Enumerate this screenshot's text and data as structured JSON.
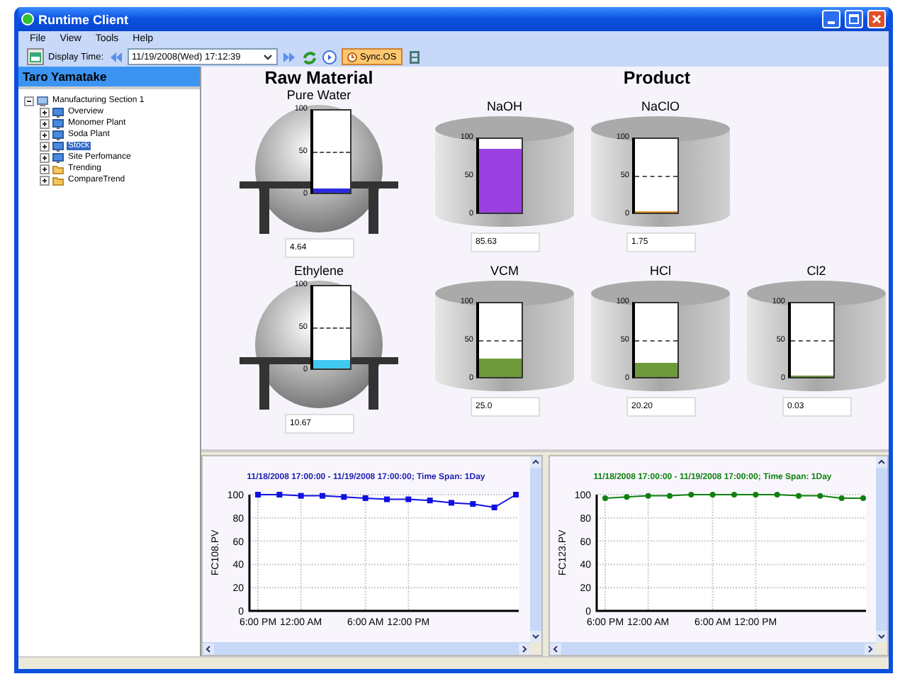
{
  "window": {
    "title": "Runtime Client"
  },
  "menu": [
    "File",
    "View",
    "Tools",
    "Help"
  ],
  "toolbar": {
    "time_label": "Display Time:",
    "time_value": "11/19/2008(Wed) 17:12:39",
    "sync_button": "Sync.OS"
  },
  "sidebar": {
    "user": "Taro Yamatake",
    "tree": [
      {
        "label": "Manufacturing Section 1",
        "kind": "site",
        "expanded": true,
        "selected": false,
        "children": [
          {
            "label": "Overview",
            "kind": "screen",
            "expanded": false,
            "selected": false
          },
          {
            "label": "Monomer Plant",
            "kind": "screen",
            "expanded": false,
            "selected": false
          },
          {
            "label": "Soda Plant",
            "kind": "screen",
            "expanded": false,
            "selected": false
          },
          {
            "label": "Stock",
            "kind": "screen",
            "expanded": false,
            "selected": true
          },
          {
            "label": "Site Perfomance",
            "kind": "screen",
            "expanded": false,
            "selected": false
          },
          {
            "label": "Trending",
            "kind": "folder",
            "expanded": false,
            "selected": false
          },
          {
            "label": "CompareTrend",
            "kind": "folder",
            "expanded": false,
            "selected": false
          }
        ]
      }
    ]
  },
  "raw_material": {
    "title": "Raw Material",
    "tanks": [
      {
        "name": "Pure Water",
        "kind": "sphere",
        "level": 0.0464,
        "color": "#2a2ae0",
        "scale": [
          "100",
          "50",
          "0"
        ],
        "reading": "4.64"
      },
      {
        "name": "Ethylene",
        "kind": "sphere",
        "level": 0.1067,
        "color": "#40c8f0",
        "scale": [
          "100",
          "50",
          "0"
        ],
        "reading": "10.67"
      }
    ]
  },
  "product": {
    "title": "Product",
    "rows": [
      [
        {
          "name": "NaOH",
          "kind": "cylinder",
          "level": 0.8563,
          "color": "#9a40e0",
          "scale": [
            "100",
            "50",
            "0"
          ],
          "reading": "85.63"
        },
        {
          "name": "NaClO",
          "kind": "cylinder",
          "level": 0.0175,
          "color": "#e8a030",
          "scale": [
            "100",
            "50",
            "0"
          ],
          "reading": "1.75"
        }
      ],
      [
        {
          "name": "VCM",
          "kind": "cylinder",
          "level": 0.25,
          "color": "#6e9a3c",
          "scale": [
            "100",
            "50",
            "0"
          ],
          "reading": "25.0"
        },
        {
          "name": "HCl",
          "kind": "cylinder",
          "level": 0.202,
          "color": "#6e9a3c",
          "scale": [
            "100",
            "50",
            "0"
          ],
          "reading": "20.20"
        },
        {
          "name": "Cl2",
          "kind": "cylinder",
          "level": 0.0003,
          "color": "#6e9a3c",
          "scale": [
            "100",
            "50",
            "0"
          ],
          "reading": "0.03"
        }
      ]
    ]
  },
  "trends": [
    {
      "title": "11/18/2008 17:00:00 - 11/19/2008 17:00:00; Time Span: 1Day",
      "color": "#2020b0",
      "chart_data": {
        "type": "line",
        "ylabel": "FC108.PV",
        "grid": true,
        "categories": [
          "6:00 PM",
          null,
          "12:00 AM",
          null,
          null,
          "6:00 AM",
          null,
          "12:00 PM",
          null,
          null,
          null,
          null,
          null
        ],
        "series": [
          {
            "color": "#1010e0",
            "marker": "square",
            "values": [
              100,
              100,
              99,
              99,
              98,
              97,
              96,
              96,
              95,
              93,
              92,
              89,
              100
            ]
          }
        ],
        "ylim": [
          0,
          100
        ],
        "yticks": [
          0,
          20,
          40,
          60,
          80,
          100
        ]
      }
    },
    {
      "title": "11/18/2008 17:00:00 - 11/19/2008 17:00:00; Time Span: 1Day",
      "color": "#108010",
      "chart_data": {
        "type": "line",
        "ylabel": "FC123.PV",
        "grid": true,
        "categories": [
          "6:00 PM",
          null,
          "12:00 AM",
          null,
          null,
          "6:00 AM",
          null,
          "12:00 PM",
          null,
          null,
          null,
          null,
          null
        ],
        "series": [
          {
            "color": "#108010",
            "marker": "circle",
            "values": [
              97,
              98,
              99,
              99,
              100,
              100,
              100,
              100,
              100,
              99,
              99,
              97,
              97
            ]
          }
        ],
        "ylim": [
          0,
          100
        ],
        "yticks": [
          0,
          20,
          40,
          60,
          80,
          100
        ]
      }
    }
  ]
}
